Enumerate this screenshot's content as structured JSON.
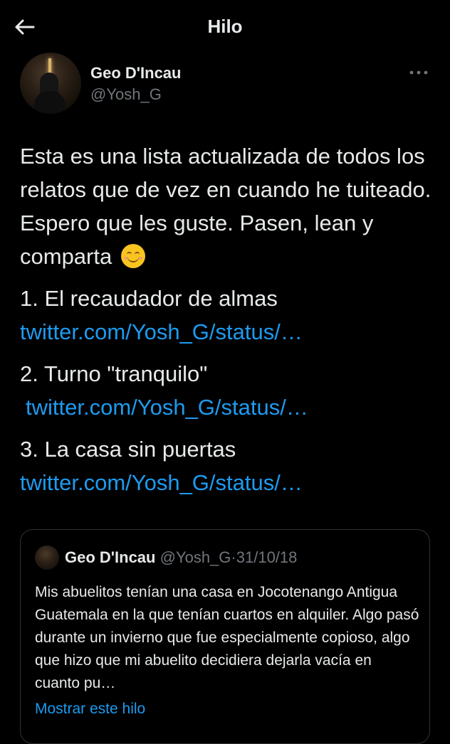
{
  "header": {
    "title": "Hilo",
    "back_icon": "arrow-left-icon"
  },
  "author": {
    "name": "Geo D'Incau",
    "handle": "@Yosh_G"
  },
  "tweet": {
    "intro": "Esta es una lista actualizada de todos los relatos que de vez en cuando he tuiteado. Espero que les guste. Pasen, lean y comparta",
    "emoji": "smiling-face-emoji",
    "items": [
      {
        "title": "1. El recaudador de almas",
        "link": "twitter.com/Yosh_G/status/…"
      },
      {
        "title": "2. Turno \"tranquilo\"",
        "link": "twitter.com/Yosh_G/status/…"
      },
      {
        "title": "3. La casa sin puertas",
        "link": "twitter.com/Yosh_G/status/…"
      }
    ]
  },
  "quote": {
    "name": "Geo D'Incau",
    "handle": "@Yosh_G",
    "separator": "·",
    "date": "31/10/18",
    "text": "Mis abuelitos tenían una casa en Jocotenango Antigua Guatemala en la que tenían cuartos en alquiler. Algo pasó durante un invierno que fue especialmente copioso, algo que hizo que mi abuelito decidiera dejarla vacía en cuanto pu…",
    "show_thread": "Mostrar este hilo"
  },
  "colors": {
    "background": "#000000",
    "text": "#e7e9ea",
    "secondary": "#71767b",
    "link": "#1d9bf0",
    "border": "#2f3336"
  }
}
